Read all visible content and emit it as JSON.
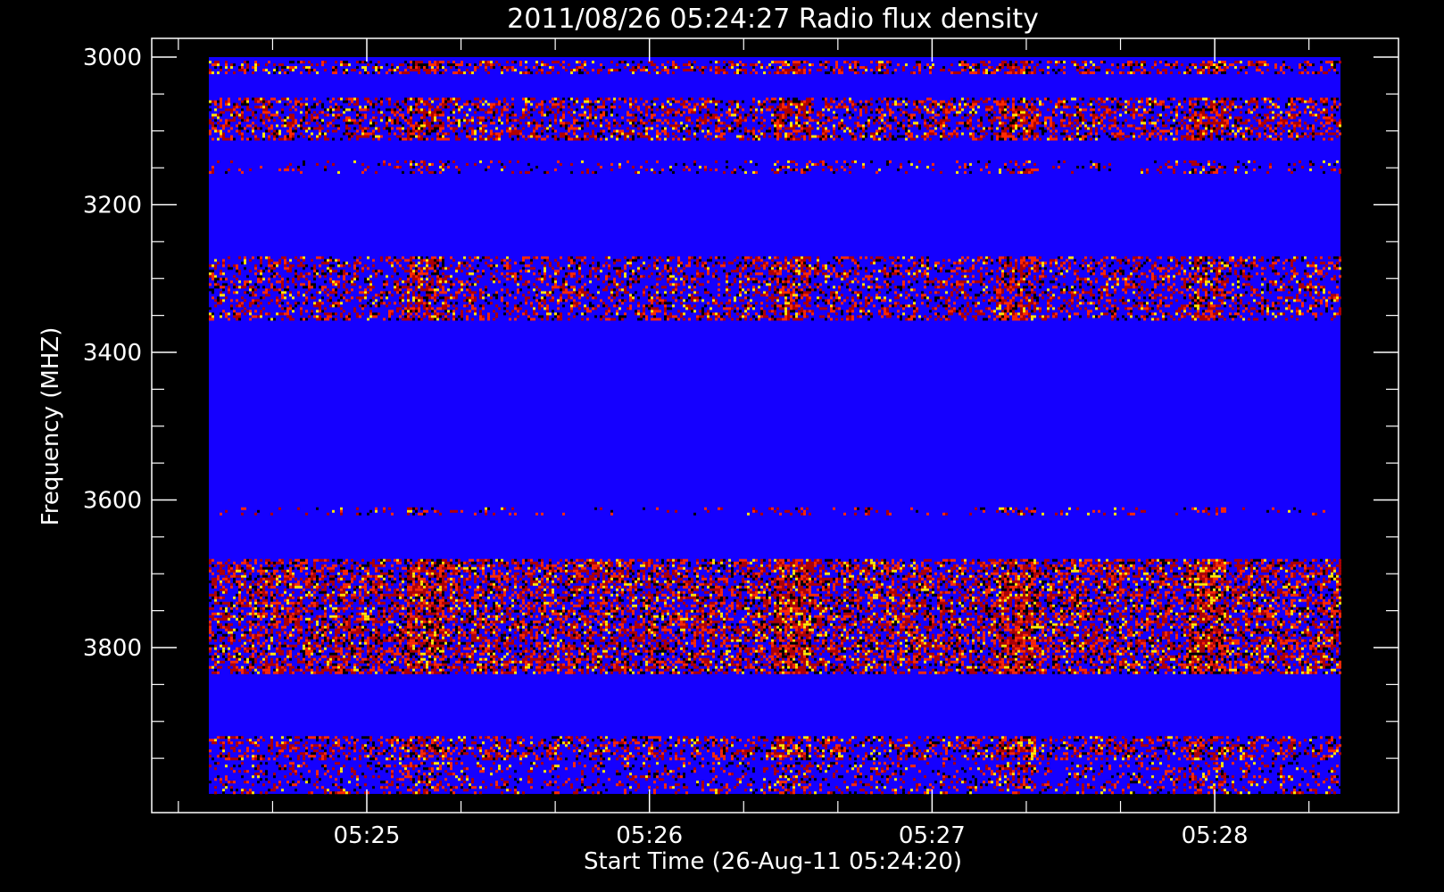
{
  "chart_data": {
    "type": "heatmap",
    "title": "2011/08/26 05:24:27 Radio flux density",
    "xlabel": "Start Time (26-Aug-11 05:24:20)",
    "ylabel": "Frequency (MHZ)",
    "x_range": [
      "05:24:20",
      "05:28:32"
    ],
    "y_range_mhz": [
      3000,
      4000
    ],
    "y_axis_inverted": true,
    "x_major_ticks": [
      "05:25",
      "05:26",
      "05:27",
      "05:28"
    ],
    "y_major_ticks": [
      3000,
      3200,
      3400,
      3600,
      3800
    ],
    "colormap": [
      "#000000",
      "#1d00ff",
      "#b00000",
      "#ff2a00",
      "#ffe600"
    ],
    "background_color": "#1500ff",
    "enhanced_bands_mhz": [
      {
        "from": 3005,
        "to": 3020,
        "intensity": 0.55
      },
      {
        "from": 3055,
        "to": 3110,
        "intensity": 0.6
      },
      {
        "from": 3140,
        "to": 3155,
        "intensity": 0.2
      },
      {
        "from": 3270,
        "to": 3355,
        "intensity": 0.5
      },
      {
        "from": 3610,
        "to": 3620,
        "intensity": 0.15
      },
      {
        "from": 3680,
        "to": 3835,
        "intensity": 0.75
      },
      {
        "from": 3920,
        "to": 3950,
        "intensity": 0.55
      },
      {
        "from": 3955,
        "to": 3995,
        "intensity": 0.3
      }
    ],
    "burst_times": [
      "05:25:12",
      "05:26:30",
      "05:27:18",
      "05:27:58"
    ]
  }
}
